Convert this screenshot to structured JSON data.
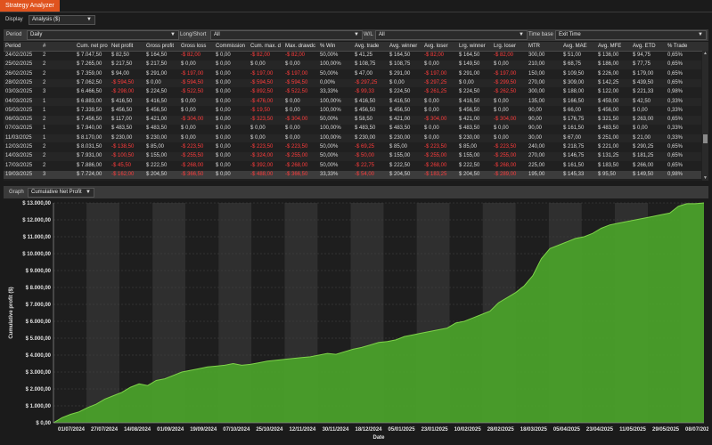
{
  "app": {
    "tab_title": "Strategy Analyzer"
  },
  "display": {
    "label": "Display",
    "value": "Analysis ($)"
  },
  "filters": {
    "period_label": "Period",
    "period_value": "Daily",
    "longshort_label": "Long/Short",
    "longshort_value": "All",
    "wl_label": "W/L",
    "wl_value": "All",
    "timebase_label": "Time base",
    "timebase_value": "Exit Time"
  },
  "table": {
    "columns": [
      "Period",
      "#",
      "Cum. net pro",
      "Net profit",
      "Gross profit",
      "Gross loss",
      "Commission",
      "Cum. max. d",
      "Max. drawdc",
      "% Win",
      "Avg. trade",
      "Avg. winner",
      "Avg. loser",
      "Lrg. winner",
      "Lrg. loser",
      "MTR",
      "Avg. MAE",
      "Avg. MFE",
      "Avg. ETD",
      "% Trade"
    ],
    "rows": [
      [
        "24/02/2025",
        "2",
        "$ 7.047,50",
        "$ 82,50",
        "$ 164,50",
        "-$ 82,00",
        "$ 0,00",
        "-$ 82,00",
        "-$ 82,00",
        "50,00%",
        "$ 41,25",
        "$ 164,50",
        "-$ 82,00",
        "$ 164,50",
        "-$ 82,00",
        "300,00",
        "$ 51,00",
        "$ 136,00",
        "$ 94,75",
        "0,65%"
      ],
      [
        "25/02/2025",
        "2",
        "$ 7.265,00",
        "$ 217,50",
        "$ 217,50",
        "$ 0,00",
        "$ 0,00",
        "$ 0,00",
        "$ 0,00",
        "100,00%",
        "$ 108,75",
        "$ 108,75",
        "$ 0,00",
        "$ 149,50",
        "$ 0,00",
        "210,00",
        "$ 68,75",
        "$ 186,00",
        "$ 77,75",
        "0,65%"
      ],
      [
        "26/02/2025",
        "2",
        "$ 7.359,00",
        "$ 94,00",
        "$ 291,00",
        "-$ 197,00",
        "$ 0,00",
        "-$ 197,00",
        "-$ 197,00",
        "50,00%",
        "$ 47,00",
        "$ 291,00",
        "-$ 197,00",
        "$ 291,00",
        "-$ 197,00",
        "150,00",
        "$ 109,50",
        "$ 226,00",
        "$ 179,00",
        "0,65%"
      ],
      [
        "28/02/2025",
        "2",
        "$ 7.062,50",
        "-$ 594,50",
        "$ 0,00",
        "-$ 594,50",
        "$ 0,00",
        "-$ 594,50",
        "-$ 594,50",
        "0,00%",
        "-$ 297,25",
        "$ 0,00",
        "-$ 297,25",
        "$ 0,00",
        "-$ 299,50",
        "270,00",
        "$ 309,00",
        "$ 142,25",
        "$ 439,50",
        "0,65%"
      ],
      [
        "03/03/2025",
        "3",
        "$ 6.466,50",
        "-$ 298,00",
        "$ 224,50",
        "-$ 522,50",
        "$ 0,00",
        "-$ 892,50",
        "-$ 522,50",
        "33,33%",
        "-$ 99,33",
        "$ 224,50",
        "-$ 261,25",
        "$ 224,50",
        "-$ 262,50",
        "300,00",
        "$ 188,00",
        "$ 122,00",
        "$ 221,33",
        "0,98%"
      ],
      [
        "04/03/2025",
        "1",
        "$ 6.883,00",
        "$ 416,50",
        "$ 416,50",
        "$ 0,00",
        "$ 0,00",
        "-$ 476,00",
        "$ 0,00",
        "100,00%",
        "$ 416,50",
        "$ 416,50",
        "$ 0,00",
        "$ 416,50",
        "$ 0,00",
        "135,00",
        "$ 166,50",
        "$ 459,00",
        "$ 42,50",
        "0,33%"
      ],
      [
        "05/03/2025",
        "1",
        "$ 7.339,50",
        "$ 456,50",
        "$ 456,50",
        "$ 0,00",
        "$ 0,00",
        "-$ 19,50",
        "$ 0,00",
        "100,00%",
        "$ 456,50",
        "$ 456,50",
        "$ 0,00",
        "$ 456,50",
        "$ 0,00",
        "90,00",
        "$ 66,00",
        "$ 456,00",
        "$ 0,00",
        "0,33%"
      ],
      [
        "06/03/2025",
        "2",
        "$ 7.456,50",
        "$ 117,00",
        "$ 421,00",
        "-$ 304,00",
        "$ 0,00",
        "-$ 323,50",
        "-$ 304,00",
        "50,00%",
        "$ 58,50",
        "$ 421,00",
        "-$ 304,00",
        "$ 421,00",
        "-$ 304,00",
        "90,00",
        "$ 176,75",
        "$ 321,50",
        "$ 263,00",
        "0,65%"
      ],
      [
        "07/03/2025",
        "1",
        "$ 7.940,00",
        "$ 483,50",
        "$ 483,50",
        "$ 0,00",
        "$ 0,00",
        "$ 0,00",
        "$ 0,00",
        "100,00%",
        "$ 483,50",
        "$ 483,50",
        "$ 0,00",
        "$ 483,50",
        "$ 0,00",
        "90,00",
        "$ 161,50",
        "$ 483,50",
        "$ 0,00",
        "0,33%"
      ],
      [
        "11/03/2025",
        "1",
        "$ 8.170,00",
        "$ 230,00",
        "$ 230,00",
        "$ 0,00",
        "$ 0,00",
        "$ 0,00",
        "$ 0,00",
        "100,00%",
        "$ 230,00",
        "$ 230,00",
        "$ 0,00",
        "$ 230,00",
        "$ 0,00",
        "30,00",
        "$ 67,00",
        "$ 251,00",
        "$ 21,00",
        "0,33%"
      ],
      [
        "12/03/2025",
        "2",
        "$ 8.031,50",
        "-$ 138,50",
        "$ 85,00",
        "-$ 223,50",
        "$ 0,00",
        "-$ 223,50",
        "-$ 223,50",
        "50,00%",
        "-$ 69,25",
        "$ 85,00",
        "-$ 223,50",
        "$ 85,00",
        "-$ 223,50",
        "240,00",
        "$ 218,75",
        "$ 221,00",
        "$ 290,25",
        "0,65%"
      ],
      [
        "14/03/2025",
        "2",
        "$ 7.931,00",
        "-$ 100,50",
        "$ 155,00",
        "-$ 255,50",
        "$ 0,00",
        "-$ 324,00",
        "-$ 255,00",
        "50,00%",
        "-$ 50,00",
        "$ 155,00",
        "-$ 255,00",
        "$ 155,00",
        "-$ 255,00",
        "270,00",
        "$ 146,75",
        "$ 131,25",
        "$ 181,25",
        "0,65%"
      ],
      [
        "17/03/2025",
        "2",
        "$ 7.886,00",
        "-$ 45,50",
        "$ 222,50",
        "-$ 268,00",
        "$ 0,00",
        "-$ 392,00",
        "-$ 268,00",
        "50,00%",
        "-$ 22,75",
        "$ 222,50",
        "-$ 268,00",
        "$ 222,50",
        "-$ 268,00",
        "225,00",
        "$ 161,50",
        "$ 183,50",
        "$ 266,00",
        "0,65%"
      ],
      [
        "19/03/2025",
        "3",
        "$ 7.724,00",
        "-$ 162,00",
        "$ 204,50",
        "-$ 366,50",
        "$ 0,00",
        "-$ 488,00",
        "-$ 366,50",
        "33,33%",
        "-$ 54,00",
        "$ 204,50",
        "-$ 183,25",
        "$ 204,50",
        "-$ 289,00",
        "195,00",
        "$ 145,33",
        "$ 95,50",
        "$ 149,50",
        "0,98%"
      ]
    ]
  },
  "graph": {
    "label": "Graph",
    "value": "Cumulative Net Profit"
  },
  "colors": {
    "accent": "#e0531e",
    "negative": "#ff3b3b",
    "fill": "#4aa02a",
    "line": "#7fd34a"
  },
  "chart_data": {
    "type": "area",
    "xlabel": "Date",
    "ylabel": "Cumulative profit ($)",
    "ylim": [
      0,
      13000
    ],
    "y_ticks": [
      "$ 0,00",
      "$ 1.000,00",
      "$ 2.000,00",
      "$ 3.000,00",
      "$ 4.000,00",
      "$ 5.000,00",
      "$ 6.000,00",
      "$ 7.000,00",
      "$ 8.000,00",
      "$ 9.000,00",
      "$ 10.000,00",
      "$ 11.000,00",
      "$ 12.000,00",
      "$ 13.000,00"
    ],
    "x_ticks": [
      "01/07/2024",
      "27/07/2024",
      "14/08/2024",
      "01/09/2024",
      "19/09/2024",
      "07/10/2024",
      "25/10/2024",
      "12/11/2024",
      "30/11/2024",
      "18/12/2024",
      "05/01/2025",
      "23/01/2025",
      "10/02/2025",
      "28/02/2025",
      "18/03/2025",
      "05/04/2025",
      "23/04/2025",
      "11/05/2025",
      "29/05/2025",
      "08/07/2025"
    ],
    "series": [
      {
        "values": [
          0,
          300,
          500,
          650,
          900,
          1100,
          1400,
          1600,
          1800,
          2100,
          2300,
          2200,
          2500,
          2600,
          2800,
          3000,
          3100,
          3200,
          3300,
          3350,
          3400,
          3500,
          3400,
          3450,
          3550,
          3650,
          3700,
          3750,
          3800,
          3850,
          3900,
          4000,
          4100,
          4050,
          4200,
          4350,
          4450,
          4600,
          4750,
          4800,
          4900,
          5100,
          5200,
          5300,
          5400,
          5500,
          5600,
          5900,
          6000,
          6200,
          6400,
          6600,
          7100,
          7400,
          7700,
          8100,
          8700,
          9700,
          10300,
          10500,
          10700,
          10900,
          11000,
          11200,
          11500,
          11700,
          11800,
          11900,
          12000,
          12100,
          12200,
          12300,
          12400,
          12800,
          12950,
          12950,
          13000
        ]
      }
    ]
  }
}
